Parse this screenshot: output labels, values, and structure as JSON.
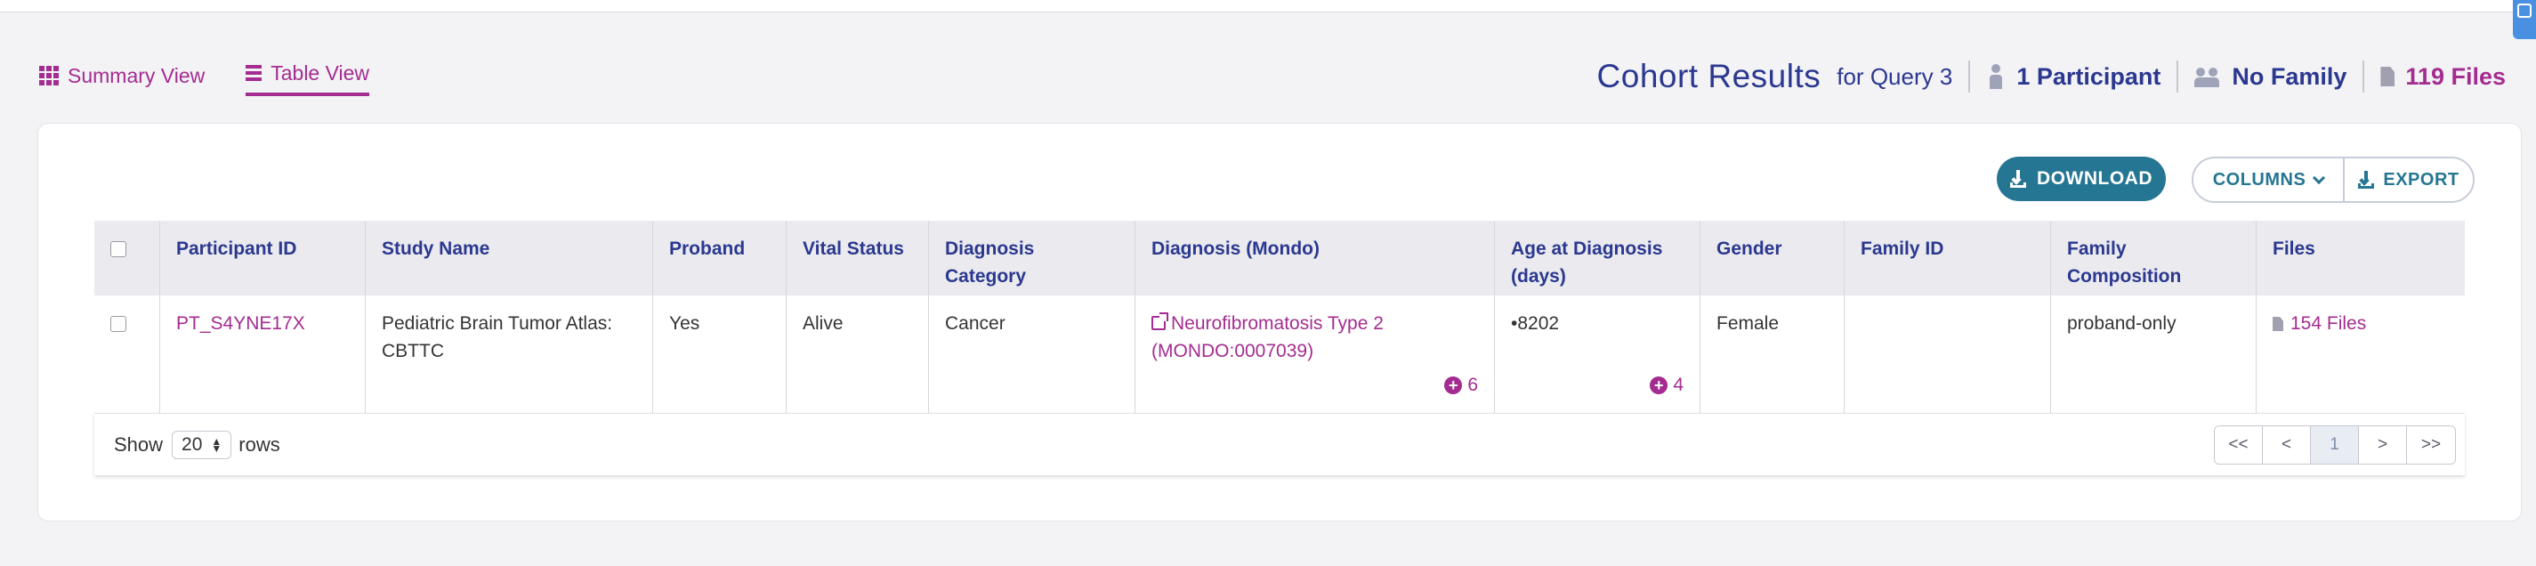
{
  "view_tabs": [
    {
      "label": "Summary View",
      "icon": "grid-icon",
      "active": false
    },
    {
      "label": "Table View",
      "icon": "list-icon",
      "active": true
    }
  ],
  "cohort": {
    "title": "Cohort Results",
    "subtitle": "for Query 3",
    "participants": "1 Participant",
    "family": "No Family",
    "files": "119 Files"
  },
  "toolbar": {
    "download_label": "DOWNLOAD",
    "columns_label": "COLUMNS",
    "export_label": "EXPORT"
  },
  "table": {
    "headers": [
      "Participant ID",
      "Study Name",
      "Proband",
      "Vital Status",
      "Diagnosis Category",
      "Diagnosis (Mondo)",
      "Age at Diagnosis (days)",
      "Gender",
      "Family ID",
      "Family Composition",
      "Files"
    ],
    "rows": [
      {
        "participant_id": "PT_S4YNE17X",
        "study_name": "Pediatric Brain Tumor Atlas: CBTTC",
        "proband": "Yes",
        "vital_status": "Alive",
        "diagnosis_category": "Cancer",
        "diagnosis_mondo": "Neurofibromatosis Type 2 (MONDO:0007039)",
        "diagnosis_more": "6",
        "age_at_diagnosis": "•8202",
        "age_more": "4",
        "gender": "Female",
        "family_id": "",
        "family_composition": "proband-only",
        "files": "154 Files"
      }
    ]
  },
  "pagination": {
    "show_label": "Show",
    "rows_value": "20",
    "rows_label": "rows",
    "buttons": [
      "<<",
      "<",
      "1",
      ">",
      ">>"
    ],
    "current": "1"
  },
  "colors": {
    "accent": "#a42c90",
    "navy": "#2b388f",
    "teal": "#257693"
  }
}
